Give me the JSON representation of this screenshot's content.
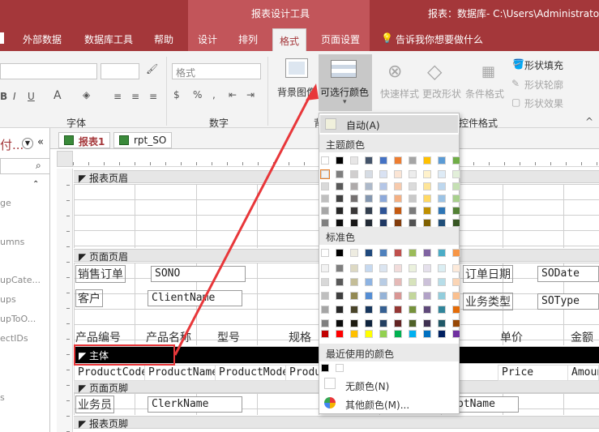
{
  "window": {
    "context_tab_group": "报表设计工具",
    "title": "报表：数据库- C:\\Users\\Administrator"
  },
  "ribbon_tabs": [
    "外部数据",
    "数据库工具",
    "帮助",
    "设计",
    "排列",
    "格式",
    "页面设置"
  ],
  "active_tab": "格式",
  "tell_me": "告诉我你想要做什么",
  "ribbon": {
    "font_group": "字体",
    "number_group": "数字",
    "background_group": "背",
    "control_format_group": "控件格式",
    "format_combo": "格式",
    "bg_image": "背景图像",
    "alt_color": "可选行颜色",
    "quick_styles": "快速样式",
    "change_shape": "更改形状",
    "cond_format": "条件格式",
    "shape_fill": "形状填充",
    "shape_outline": "形状轮廓",
    "shape_effect": "形状效果",
    "bold": "B",
    "italic": "I",
    "underline": "U",
    "font_color": "A",
    "percent": "%",
    "comma": ","
  },
  "nav": {
    "title": "付...",
    "search_icon": "search-icon",
    "items": [
      "ge",
      "umns",
      "upCate...",
      "ups",
      "upToO...",
      "ectIDs",
      "s"
    ]
  },
  "doc_tabs": [
    "报表1",
    "rpt_SO"
  ],
  "sections": {
    "report_header": "报表页眉",
    "page_header": "页面页眉",
    "detail": "主体",
    "page_footer": "页面页脚",
    "report_footer": "报表页脚"
  },
  "labels": {
    "so_label": "销售订单",
    "client_label": "客户",
    "date_label": "订单日期",
    "type_label": "业务类型",
    "clerk_label": "业务员",
    "col_code": "产品编号",
    "col_name": "产品名称",
    "col_model": "型号",
    "col_spec": "规格",
    "col_price": "单价",
    "col_amount": "金额"
  },
  "fields": {
    "sono": "SONO",
    "client": "ClientName",
    "sodate": "SODate",
    "sotype": "SOType",
    "clerk": "ClerkName",
    "ptname": "ptName",
    "pcode": "ProductCode",
    "pname": "ProductName",
    "pmodel": "ProductMode",
    "pspec": "Produ",
    "price": "Price",
    "amount": "Amoun"
  },
  "popup": {
    "auto": "自动(A)",
    "theme_colors": "主题颜色",
    "std_colors": "标准色",
    "recent_colors": "最近使用的颜色",
    "no_color": "无颜色(N)",
    "more_colors": "其他颜色(M)..."
  },
  "colors": {
    "accent": "#a4373a",
    "annotation_red": "#e8373a",
    "theme_top": [
      "#ffffff",
      "#000000",
      "#e7e6e6",
      "#44546a",
      "#4472c4",
      "#ed7d31",
      "#a5a5a5",
      "#ffc000",
      "#5b9bd5",
      "#70ad47"
    ],
    "theme_cols": [
      [
        "#f2f2f2",
        "#d9d9d9",
        "#bfbfbf",
        "#a6a6a6",
        "#808080"
      ],
      [
        "#7f7f7f",
        "#595959",
        "#404040",
        "#262626",
        "#0d0d0d"
      ],
      [
        "#d0cece",
        "#aeaaaa",
        "#757171",
        "#3a3838",
        "#171616"
      ],
      [
        "#d6dce4",
        "#adb9ca",
        "#8497b0",
        "#333f4f",
        "#222a35"
      ],
      [
        "#d9e2f3",
        "#b4c6e7",
        "#8eaadb",
        "#2f5496",
        "#1f3864"
      ],
      [
        "#fbe5d5",
        "#f7caac",
        "#f4b083",
        "#c55a11",
        "#833c0b"
      ],
      [
        "#ededed",
        "#dbdbdb",
        "#c9c9c9",
        "#7b7b7b",
        "#525252"
      ],
      [
        "#fff2cc",
        "#fee599",
        "#ffd965",
        "#bf8f00",
        "#7f6000"
      ],
      [
        "#deebf6",
        "#bdd7ee",
        "#9cc3e5",
        "#2e75b5",
        "#1f4e79"
      ],
      [
        "#e2efd9",
        "#c5e0b3",
        "#a8d08d",
        "#538135",
        "#375623"
      ]
    ],
    "std_top": [
      "#ffffff",
      "#000000",
      "#eeece1",
      "#1f497d",
      "#4f81bd",
      "#c0504d",
      "#9bbb59",
      "#8064a2",
      "#4bacc6",
      "#f79646"
    ],
    "std_cols": [
      [
        "#f2f2f2",
        "#d8d8d8",
        "#bfbfbf",
        "#a5a5a5",
        "#7f7f7f"
      ],
      [
        "#7f7f7f",
        "#595959",
        "#3f3f3f",
        "#262626",
        "#0c0c0c"
      ],
      [
        "#ddd9c3",
        "#c4bd97",
        "#938953",
        "#494429",
        "#1d1b10"
      ],
      [
        "#c6d9f0",
        "#8db3e2",
        "#548dd4",
        "#17365d",
        "#0f243e"
      ],
      [
        "#dbe5f1",
        "#b8cce4",
        "#95b3d7",
        "#366092",
        "#244061"
      ],
      [
        "#f2dcdb",
        "#e5b9b7",
        "#d99694",
        "#953734",
        "#632423"
      ],
      [
        "#ebf1dd",
        "#d7e3bc",
        "#c3d69b",
        "#76923c",
        "#4f6128"
      ],
      [
        "#e5e0ec",
        "#ccc1d9",
        "#b2a2c7",
        "#5f497a",
        "#3f3151"
      ],
      [
        "#dbeef3",
        "#b7dde8",
        "#92cddc",
        "#31859b",
        "#205867"
      ],
      [
        "#fdeada",
        "#fbd5b5",
        "#fac08f",
        "#e36c09",
        "#974806"
      ]
    ],
    "bright": [
      "#c00000",
      "#ff0000",
      "#ffc000",
      "#ffff00",
      "#92d050",
      "#00b050",
      "#00b0f0",
      "#0070c0",
      "#002060",
      "#7030a0"
    ],
    "recent": [
      "#000000",
      "#ffffff"
    ]
  }
}
